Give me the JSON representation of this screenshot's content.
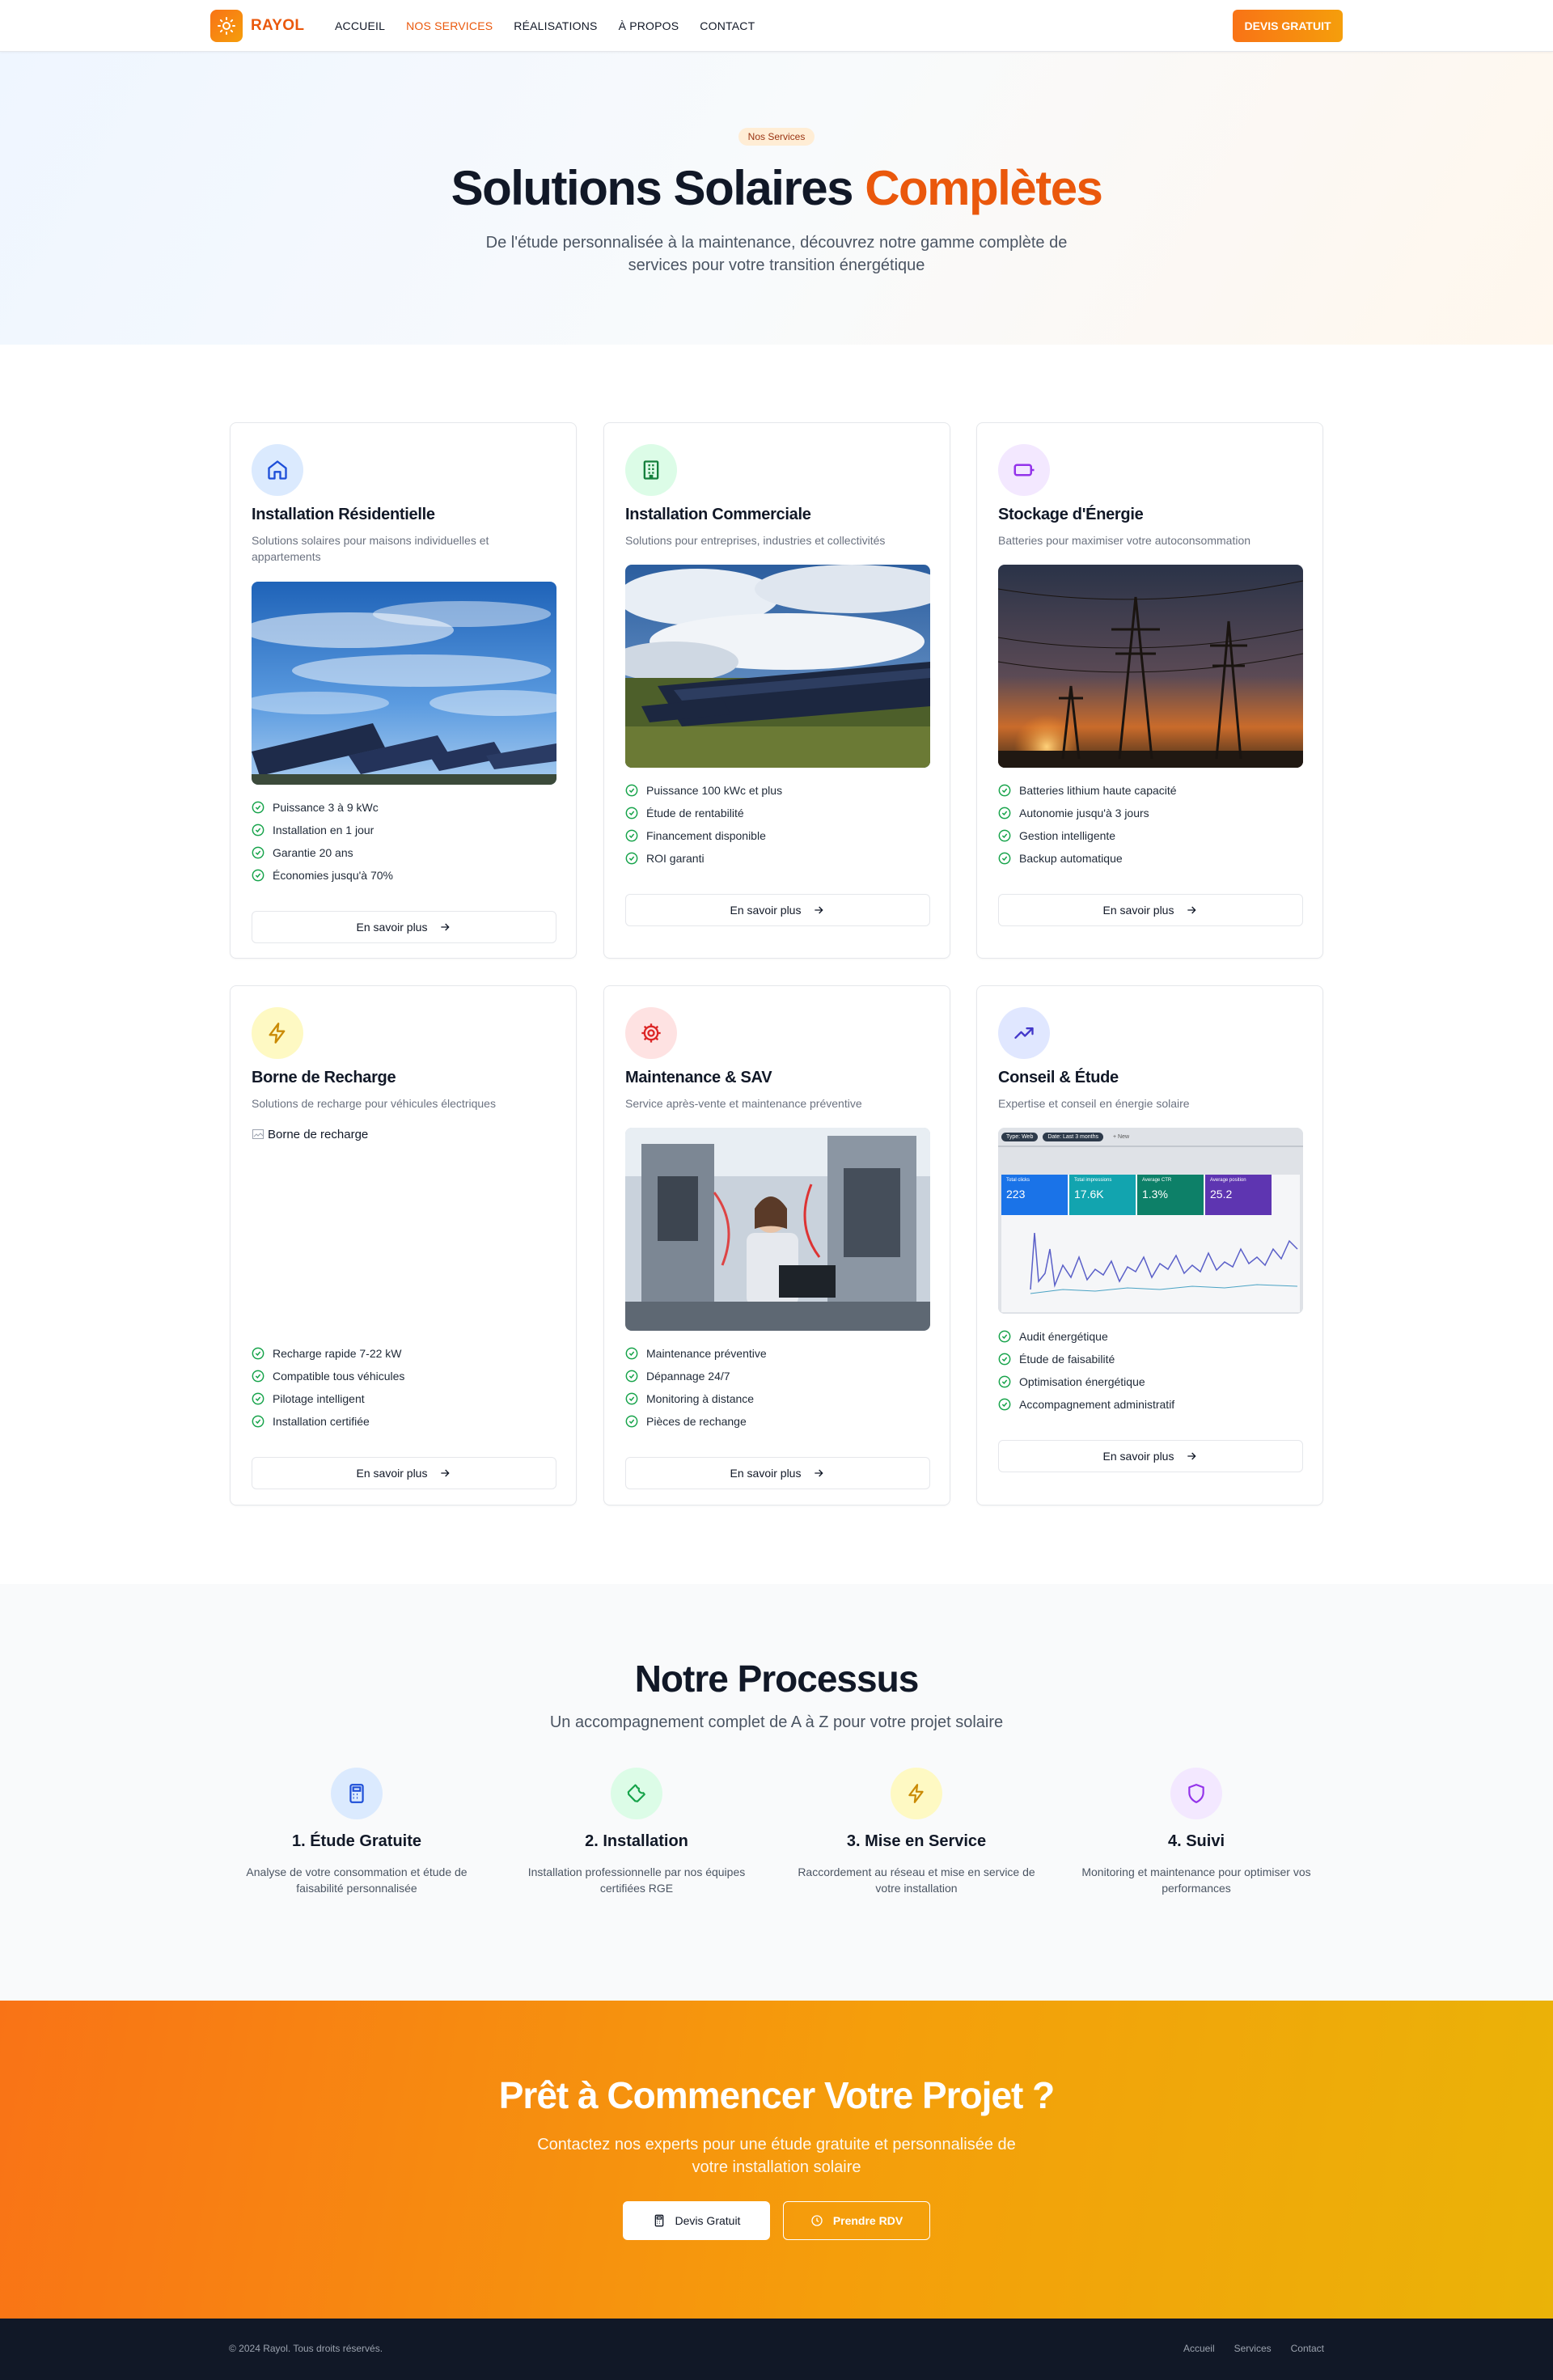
{
  "nav": {
    "brand": "RAYOL",
    "links": [
      "ACCUEIL",
      "NOS SERVICES",
      "RÉALISATIONS",
      "À PROPOS",
      "CONTACT"
    ],
    "active_index": 1,
    "cta": "DEVIS GRATUIT"
  },
  "hero": {
    "badge": "Nos Services",
    "title_main": "Solutions Solaires",
    "title_accent": "Complètes",
    "subtitle": "De l'étude personnalisée à la maintenance, découvrez notre gamme complète de services pour votre transition énergétique"
  },
  "services": [
    {
      "icon": "home-icon",
      "icon_bg": "#dbeafe",
      "icon_color": "#1d4ed8",
      "title": "Installation Résidentielle",
      "description": "Solutions solaires pour maisons individuelles et appartements",
      "image": "solar-field-blue-sky",
      "features": [
        "Puissance 3 à 9 kWc",
        "Installation en 1 jour",
        "Garantie 20 ans",
        "Économies jusqu'à 70%"
      ],
      "button": "En savoir plus"
    },
    {
      "icon": "building-icon",
      "icon_bg": "#dcfce7",
      "icon_color": "#15803d",
      "title": "Installation Commerciale",
      "description": "Solutions pour entreprises, industries et collectivités",
      "image": "solar-farm-cloudy",
      "features": [
        "Puissance 100 kWc et plus",
        "Étude de rentabilité",
        "Financement disponible",
        "ROI garanti"
      ],
      "button": "En savoir plus"
    },
    {
      "icon": "battery-icon",
      "icon_bg": "#f3e8ff",
      "icon_color": "#9333ea",
      "title": "Stockage d'Énergie",
      "description": "Batteries pour maximiser votre autoconsommation",
      "image": "power-lines-sunset",
      "features": [
        "Batteries lithium haute capacité",
        "Autonomie jusqu'à 3 jours",
        "Gestion intelligente",
        "Backup automatique"
      ],
      "button": "En savoir plus"
    },
    {
      "icon": "lightning-icon",
      "icon_bg": "#fef9c3",
      "icon_color": "#ca8a04",
      "title": "Borne de Recharge",
      "description": "Solutions de recharge pour véhicules électriques",
      "image_alt": "Borne de recharge",
      "features": [
        "Recharge rapide 7-22 kW",
        "Compatible tous véhicules",
        "Pilotage intelligent",
        "Installation certifiée"
      ],
      "button": "En savoir plus"
    },
    {
      "icon": "settings-icon",
      "icon_bg": "#fee2e2",
      "icon_color": "#dc2626",
      "title": "Maintenance & SAV",
      "description": "Service après-vente et maintenance préventive",
      "image": "technician-lab",
      "features": [
        "Maintenance préventive",
        "Dépannage 24/7",
        "Monitoring à distance",
        "Pièces de rechange"
      ],
      "button": "En savoir plus"
    },
    {
      "icon": "trending-up-icon",
      "icon_bg": "#e0e7ff",
      "icon_color": "#4338ca",
      "title": "Conseil & Étude",
      "description": "Expertise et conseil en énergie solaire",
      "image": "analytics-dashboard",
      "features": [
        "Audit énergétique",
        "Étude de faisabilité",
        "Optimisation énergétique",
        "Accompagnement administratif"
      ],
      "button": "En savoir plus",
      "dashboard": {
        "chips": [
          "Type: Web",
          "Date: Last 3 months",
          "+ New"
        ],
        "tiles": [
          {
            "label": "Total clicks",
            "value": "223",
            "color": "#1a73e8"
          },
          {
            "label": "Total impressions",
            "value": "17.6K",
            "color": "#12a4af"
          },
          {
            "label": "Average CTR",
            "value": "1.3%",
            "color": "#0d8068"
          },
          {
            "label": "Average position",
            "value": "25.2",
            "color": "#5e35b1"
          }
        ]
      }
    }
  ],
  "process": {
    "title": "Notre Processus",
    "subtitle": "Un accompagnement complet de A à Z pour votre projet solaire",
    "steps": [
      {
        "icon": "calculator-icon",
        "icon_bg": "#dbeafe",
        "icon_color": "#1d4ed8",
        "title": "1. Étude Gratuite",
        "description": "Analyse de votre consommation et étude de faisabilité personnalisée"
      },
      {
        "icon": "wrench-icon",
        "icon_bg": "#dcfce7",
        "icon_color": "#16a34a",
        "title": "2. Installation",
        "description": "Installation professionnelle par nos équipes certifiées RGE"
      },
      {
        "icon": "lightning-icon",
        "icon_bg": "#fef9c3",
        "icon_color": "#ca8a04",
        "title": "3. Mise en Service",
        "description": "Raccordement au réseau et mise en service de votre installation"
      },
      {
        "icon": "shield-icon",
        "icon_bg": "#f3e8ff",
        "icon_color": "#9333ea",
        "title": "4. Suivi",
        "description": "Monitoring et maintenance pour optimiser vos performances"
      }
    ]
  },
  "cta": {
    "title": "Prêt à Commencer Votre Projet ?",
    "subtitle": "Contactez nos experts pour une étude gratuite et personnalisée de votre installation solaire",
    "primary": "Devis Gratuit",
    "secondary": "Prendre RDV"
  },
  "footer": {
    "copyright": "© 2024 Rayol. Tous droits réservés.",
    "links": [
      "Accueil",
      "Services",
      "Contact"
    ]
  },
  "colors": {
    "accent": "#ea580c",
    "accent_light": "#f59e0b",
    "check": "#16a34a",
    "footer_bg": "#111827"
  }
}
